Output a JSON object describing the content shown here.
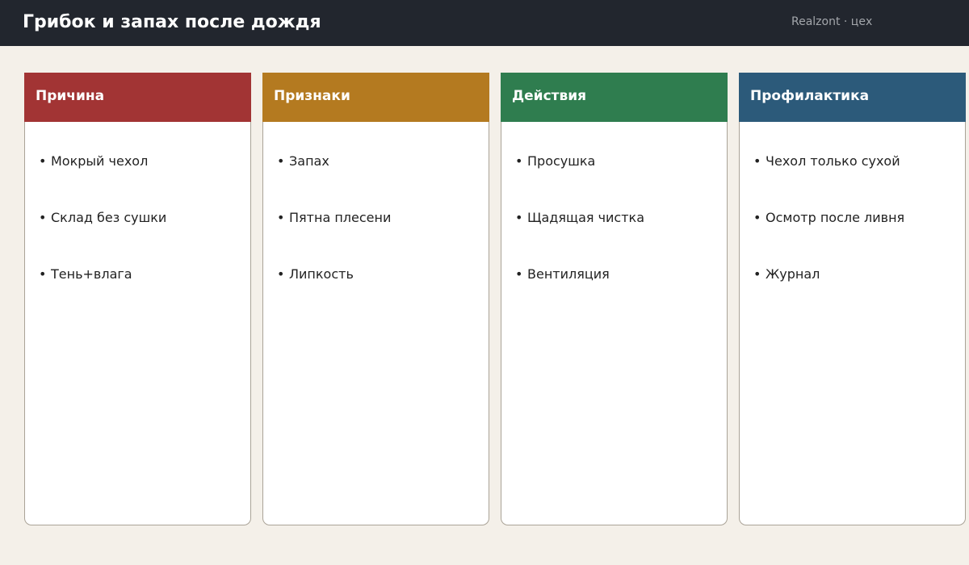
{
  "header": {
    "title": "Грибок и запах после дождя",
    "brand": "Realzont · цех"
  },
  "columns": [
    {
      "title": "Причина",
      "color": "#a23434",
      "items": [
        "Мокрый чехол",
        "Склад без сушки",
        "Тень+влага"
      ]
    },
    {
      "title": "Признаки",
      "color": "#b47a20",
      "items": [
        "Запах",
        "Пятна плесени",
        "Липкость"
      ]
    },
    {
      "title": "Действия",
      "color": "#2f7d4f",
      "items": [
        "Просушка",
        "Щадящая чистка",
        "Вентиляция"
      ]
    },
    {
      "title": "Профилактика",
      "color": "#2c5a7a",
      "items": [
        "Чехол только сухой",
        "Осмотр после ливня",
        "Журнал"
      ]
    }
  ]
}
